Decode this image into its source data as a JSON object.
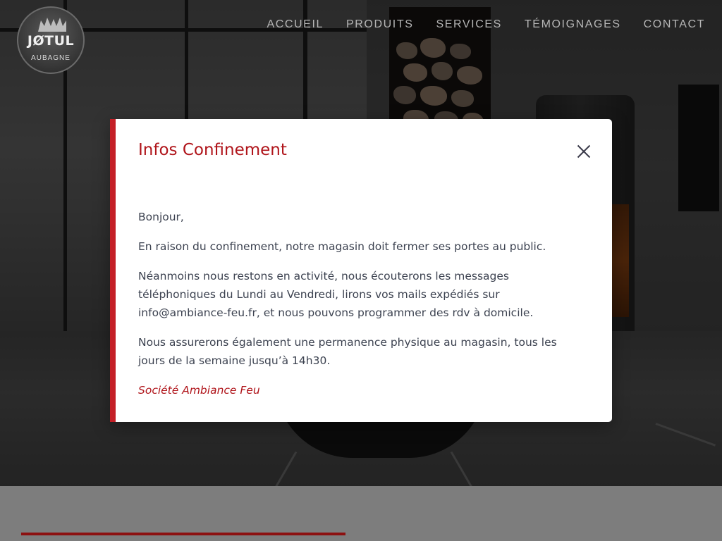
{
  "header": {
    "logo": {
      "brand": "JØTUL",
      "city": "AUBAGNE"
    },
    "nav": [
      {
        "label": "ACCUEIL"
      },
      {
        "label": "PRODUITS"
      },
      {
        "label": "SERVICES"
      },
      {
        "label": "TÉMOIGNAGES"
      },
      {
        "label": "CONTACT"
      }
    ]
  },
  "modal": {
    "title": "Infos Confinement",
    "close_icon": "close-icon",
    "paragraphs": [
      "Bonjour,",
      "En raison du confinement, notre magasin doit fermer ses portes au public.",
      "Néanmoins nous restons en activité, nous écouterons les messages téléphoniques du Lundi au Vendredi, lirons vos mails expédiés sur info@ambiance-feu.fr, et nous pouvons programmer des rdv à domicile.",
      "Nous assurerons également une permanence physique au magasin, tous les jours de la semaine jusqu’à 14h30."
    ],
    "signature": "Société Ambiance Feu"
  },
  "colors": {
    "accent": "#c41f26",
    "title": "#b0151b",
    "body_text": "#3c4250",
    "nav_text": "#b6b6b6"
  }
}
